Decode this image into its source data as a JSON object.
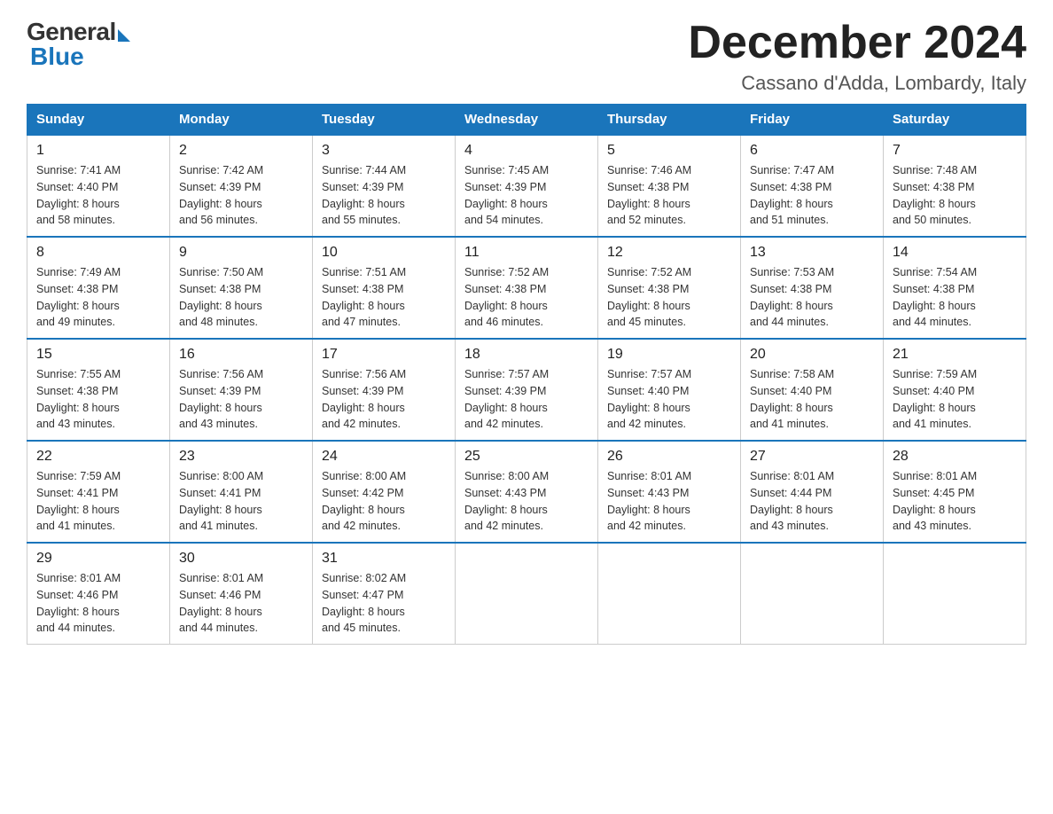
{
  "logo": {
    "general": "General",
    "blue": "Blue"
  },
  "title": "December 2024",
  "location": "Cassano d'Adda, Lombardy, Italy",
  "days_of_week": [
    "Sunday",
    "Monday",
    "Tuesday",
    "Wednesday",
    "Thursday",
    "Friday",
    "Saturday"
  ],
  "weeks": [
    [
      {
        "day": "1",
        "sunrise": "7:41 AM",
        "sunset": "4:40 PM",
        "daylight": "8 hours and 58 minutes."
      },
      {
        "day": "2",
        "sunrise": "7:42 AM",
        "sunset": "4:39 PM",
        "daylight": "8 hours and 56 minutes."
      },
      {
        "day": "3",
        "sunrise": "7:44 AM",
        "sunset": "4:39 PM",
        "daylight": "8 hours and 55 minutes."
      },
      {
        "day": "4",
        "sunrise": "7:45 AM",
        "sunset": "4:39 PM",
        "daylight": "8 hours and 54 minutes."
      },
      {
        "day": "5",
        "sunrise": "7:46 AM",
        "sunset": "4:38 PM",
        "daylight": "8 hours and 52 minutes."
      },
      {
        "day": "6",
        "sunrise": "7:47 AM",
        "sunset": "4:38 PM",
        "daylight": "8 hours and 51 minutes."
      },
      {
        "day": "7",
        "sunrise": "7:48 AM",
        "sunset": "4:38 PM",
        "daylight": "8 hours and 50 minutes."
      }
    ],
    [
      {
        "day": "8",
        "sunrise": "7:49 AM",
        "sunset": "4:38 PM",
        "daylight": "8 hours and 49 minutes."
      },
      {
        "day": "9",
        "sunrise": "7:50 AM",
        "sunset": "4:38 PM",
        "daylight": "8 hours and 48 minutes."
      },
      {
        "day": "10",
        "sunrise": "7:51 AM",
        "sunset": "4:38 PM",
        "daylight": "8 hours and 47 minutes."
      },
      {
        "day": "11",
        "sunrise": "7:52 AM",
        "sunset": "4:38 PM",
        "daylight": "8 hours and 46 minutes."
      },
      {
        "day": "12",
        "sunrise": "7:52 AM",
        "sunset": "4:38 PM",
        "daylight": "8 hours and 45 minutes."
      },
      {
        "day": "13",
        "sunrise": "7:53 AM",
        "sunset": "4:38 PM",
        "daylight": "8 hours and 44 minutes."
      },
      {
        "day": "14",
        "sunrise": "7:54 AM",
        "sunset": "4:38 PM",
        "daylight": "8 hours and 44 minutes."
      }
    ],
    [
      {
        "day": "15",
        "sunrise": "7:55 AM",
        "sunset": "4:38 PM",
        "daylight": "8 hours and 43 minutes."
      },
      {
        "day": "16",
        "sunrise": "7:56 AM",
        "sunset": "4:39 PM",
        "daylight": "8 hours and 43 minutes."
      },
      {
        "day": "17",
        "sunrise": "7:56 AM",
        "sunset": "4:39 PM",
        "daylight": "8 hours and 42 minutes."
      },
      {
        "day": "18",
        "sunrise": "7:57 AM",
        "sunset": "4:39 PM",
        "daylight": "8 hours and 42 minutes."
      },
      {
        "day": "19",
        "sunrise": "7:57 AM",
        "sunset": "4:40 PM",
        "daylight": "8 hours and 42 minutes."
      },
      {
        "day": "20",
        "sunrise": "7:58 AM",
        "sunset": "4:40 PM",
        "daylight": "8 hours and 41 minutes."
      },
      {
        "day": "21",
        "sunrise": "7:59 AM",
        "sunset": "4:40 PM",
        "daylight": "8 hours and 41 minutes."
      }
    ],
    [
      {
        "day": "22",
        "sunrise": "7:59 AM",
        "sunset": "4:41 PM",
        "daylight": "8 hours and 41 minutes."
      },
      {
        "day": "23",
        "sunrise": "8:00 AM",
        "sunset": "4:41 PM",
        "daylight": "8 hours and 41 minutes."
      },
      {
        "day": "24",
        "sunrise": "8:00 AM",
        "sunset": "4:42 PM",
        "daylight": "8 hours and 42 minutes."
      },
      {
        "day": "25",
        "sunrise": "8:00 AM",
        "sunset": "4:43 PM",
        "daylight": "8 hours and 42 minutes."
      },
      {
        "day": "26",
        "sunrise": "8:01 AM",
        "sunset": "4:43 PM",
        "daylight": "8 hours and 42 minutes."
      },
      {
        "day": "27",
        "sunrise": "8:01 AM",
        "sunset": "4:44 PM",
        "daylight": "8 hours and 43 minutes."
      },
      {
        "day": "28",
        "sunrise": "8:01 AM",
        "sunset": "4:45 PM",
        "daylight": "8 hours and 43 minutes."
      }
    ],
    [
      {
        "day": "29",
        "sunrise": "8:01 AM",
        "sunset": "4:46 PM",
        "daylight": "8 hours and 44 minutes."
      },
      {
        "day": "30",
        "sunrise": "8:01 AM",
        "sunset": "4:46 PM",
        "daylight": "8 hours and 44 minutes."
      },
      {
        "day": "31",
        "sunrise": "8:02 AM",
        "sunset": "4:47 PM",
        "daylight": "8 hours and 45 minutes."
      },
      null,
      null,
      null,
      null
    ]
  ],
  "labels": {
    "sunrise": "Sunrise:",
    "sunset": "Sunset:",
    "daylight": "Daylight:"
  }
}
